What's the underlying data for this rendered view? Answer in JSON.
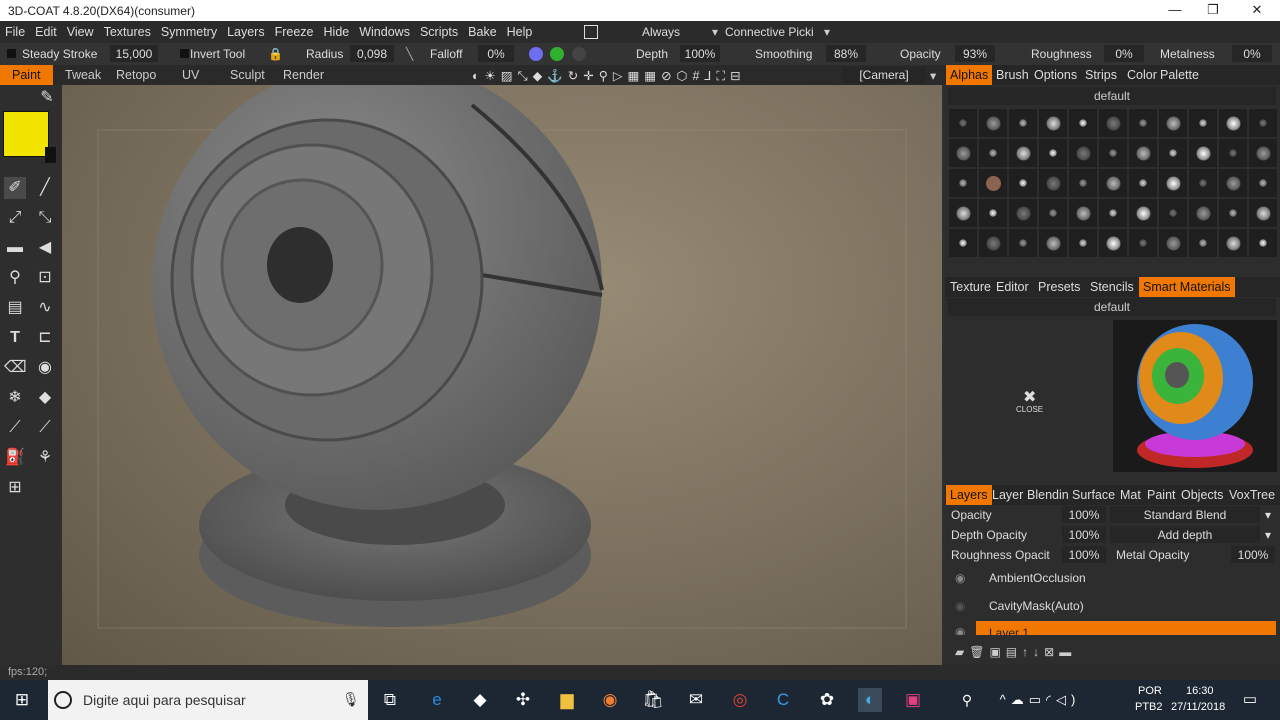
{
  "title": "3D-COAT 4.8.20(DX64)(consumer)",
  "window_controls": {
    "minimize": "—",
    "maximize": "❐",
    "close": "✕"
  },
  "menu": [
    "File",
    "Edit",
    "View",
    "Textures",
    "Symmetry",
    "Layers",
    "Freeze",
    "Hide",
    "Windows",
    "Scripts",
    "Bake",
    "Help"
  ],
  "menu_right": {
    "always": "Always",
    "connective": "Connective  Picki"
  },
  "options": {
    "steady_stroke": "Steady  Stroke",
    "steady_value": "15,000",
    "invert_tool": "Invert  Tool",
    "radius": "Radius",
    "radius_value": "0,098",
    "falloff": "Falloff",
    "falloff_value": "0%",
    "depth": "Depth",
    "depth_value": "100%",
    "smoothing": "Smoothing",
    "smoothing_value": "88%",
    "opacity": "Opacity",
    "opacity_value": "93%",
    "roughness": "Roughness",
    "roughness_value": "0%",
    "metalness": "Metalness",
    "metalness_value": "0%"
  },
  "modes": [
    "Paint",
    "Tweak",
    "Retopo",
    "UV",
    "Sculpt",
    "Render"
  ],
  "camera": "[Camera]",
  "primary_color": "#f2e600",
  "accent": "#f07800",
  "alphas_panel": {
    "tabs": [
      "Alphas",
      "Brush",
      "Options",
      "Strips",
      "Color",
      "Palette"
    ],
    "preset": "default"
  },
  "materials_panel": {
    "tabs": [
      "Texture",
      "Editor",
      "Presets",
      "Stencils",
      "Smart  Materials"
    ],
    "preset": "default",
    "close_label": "CLOSE"
  },
  "layers_panel": {
    "tabs": [
      "Layers",
      "Layer",
      "Blendin",
      "Surface",
      "Mat",
      "Paint",
      "Objects",
      "VoxTree"
    ],
    "opacity_label": "Opacity",
    "opacity_value": "100%",
    "blend_mode": "Standard Blend",
    "depth_opacity_label": "Depth  Opacity",
    "depth_opacity_value": "100%",
    "depth_mode": "Add  depth",
    "roughness_opacity_label": "Roughness  Opacit",
    "roughness_opacity_value": "100%",
    "metal_opacity_label": "Metal  Opacity",
    "metal_opacity_value": "100%",
    "layers": [
      "AmbientOcclusion",
      "CavityMask(Auto)",
      "Layer  1"
    ]
  },
  "status": "fps:120;",
  "taskbar": {
    "search_placeholder": "Digite aqui para pesquisar",
    "lang": "POR",
    "layout": "PTB2",
    "time": "16:30",
    "date": "27/11/2018"
  }
}
